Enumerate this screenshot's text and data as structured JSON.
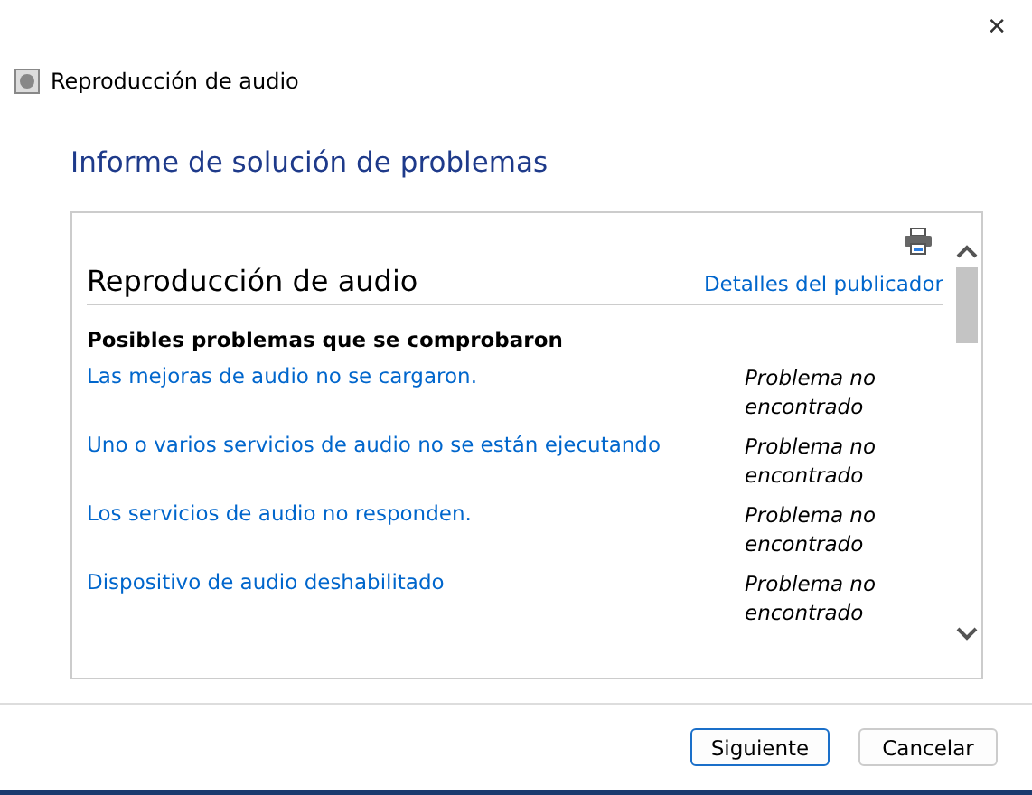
{
  "window": {
    "title": "Reproducción de audio",
    "close": "✕"
  },
  "heading": "Informe de solución de problemas",
  "report": {
    "title": "Reproducción de audio",
    "publisher_link": "Detalles del publicador",
    "section": "Posibles problemas que se comprobaron",
    "problems": [
      {
        "name": "Las mejoras de audio no se cargaron.",
        "status": "Problema no encontrado"
      },
      {
        "name": "Uno o varios servicios de audio no se están ejecutando",
        "status": "Problema no encontrado"
      },
      {
        "name": "Los servicios de audio no responden.",
        "status": "Problema no encontrado"
      },
      {
        "name": "Dispositivo de audio deshabilitado",
        "status": "Problema no encontrado"
      }
    ]
  },
  "buttons": [
    {
      "label": "Siguiente",
      "default": true
    },
    {
      "label": "Cancelar",
      "default": false
    }
  ]
}
